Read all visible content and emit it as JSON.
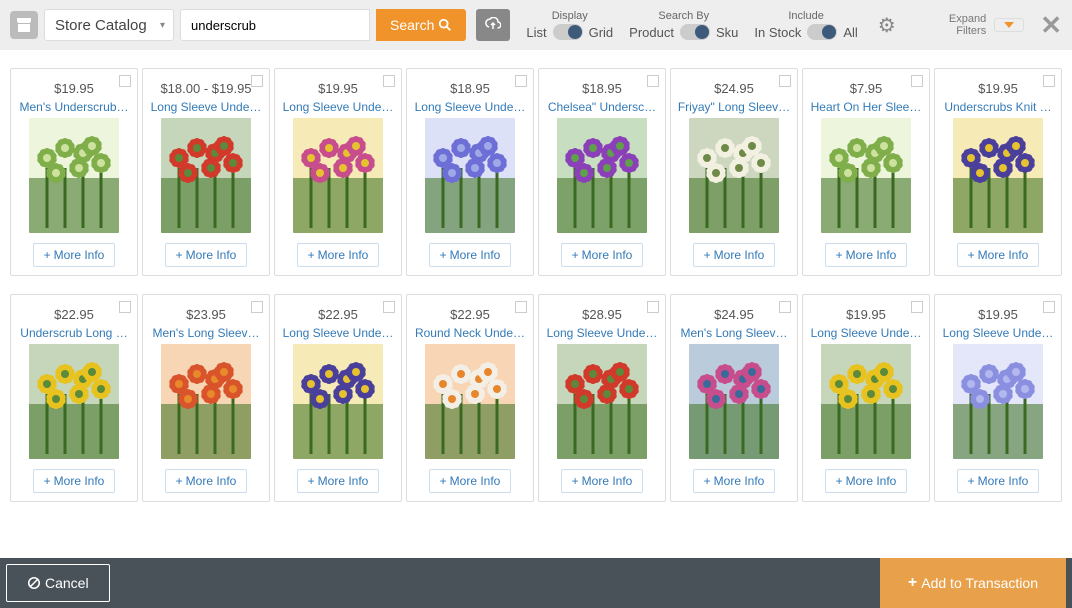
{
  "topbar": {
    "catalog": "Store Catalog",
    "search_value": "underscrub",
    "search_btn": "Search",
    "display": {
      "label": "Display",
      "left": "List",
      "right": "Grid"
    },
    "searchby": {
      "label": "Search By",
      "left": "Product",
      "right": "Sku"
    },
    "include": {
      "label": "Include",
      "left": "In Stock",
      "right": "All"
    },
    "expand": "Expand\nFilters"
  },
  "more_info": "More Info",
  "products": [
    {
      "price": "$19.95",
      "title": "Men's Underscrub…",
      "c1": "#7fae4b",
      "c2": "#cde29e"
    },
    {
      "price": "$18.00 - $19.95",
      "title": "Long Sleeve Unde…",
      "c1": "#d13a2a",
      "c2": "#5a8a3a"
    },
    {
      "price": "$19.95",
      "title": "Long Sleeve Unde…",
      "c1": "#c84d8c",
      "c2": "#e6c22e"
    },
    {
      "price": "$18.95",
      "title": "Long Sleeve Unde…",
      "c1": "#6d6fd6",
      "c2": "#9fa9e8"
    },
    {
      "price": "$18.95",
      "title": "Chelsea\" Undersc…",
      "c1": "#8b3fb8",
      "c2": "#5fa14a"
    },
    {
      "price": "$24.95",
      "title": "Friyay\" Long Sleev…",
      "c1": "#f2f0e0",
      "c2": "#6f8a46"
    },
    {
      "price": "$7.95",
      "title": "Heart On Her Slee…",
      "c1": "#7fae4b",
      "c2": "#cde29e"
    },
    {
      "price": "$19.95",
      "title": "Underscrubs Knit …",
      "c1": "#4a3f9a",
      "c2": "#e6c22e"
    },
    {
      "price": "$22.95",
      "title": "Underscrub Long …",
      "c1": "#e8c21e",
      "c2": "#5a8a3a"
    },
    {
      "price": "$23.95",
      "title": "Men's Long Sleev…",
      "c1": "#d9532b",
      "c2": "#e88a2b"
    },
    {
      "price": "$22.95",
      "title": "Long Sleeve Unde…",
      "c1": "#4a3f9a",
      "c2": "#e6c22e"
    },
    {
      "price": "$22.95",
      "title": "Round Neck Unde…",
      "c1": "#f4efe6",
      "c2": "#e8862b"
    },
    {
      "price": "$28.95",
      "title": "Long Sleeve Unde…",
      "c1": "#d13a2a",
      "c2": "#5a8a3a"
    },
    {
      "price": "$24.95",
      "title": "Men's Long Sleev…",
      "c1": "#c84d8c",
      "c2": "#3a6a9a"
    },
    {
      "price": "$19.95",
      "title": "Long Sleeve Unde…",
      "c1": "#e8c21e",
      "c2": "#5a8a3a"
    },
    {
      "price": "$19.95",
      "title": "Long Sleeve Unde…",
      "c1": "#8b8fe0",
      "c2": "#b2b8ee"
    }
  ],
  "bottom": {
    "cancel": "Cancel",
    "add": "Add to Transaction"
  }
}
